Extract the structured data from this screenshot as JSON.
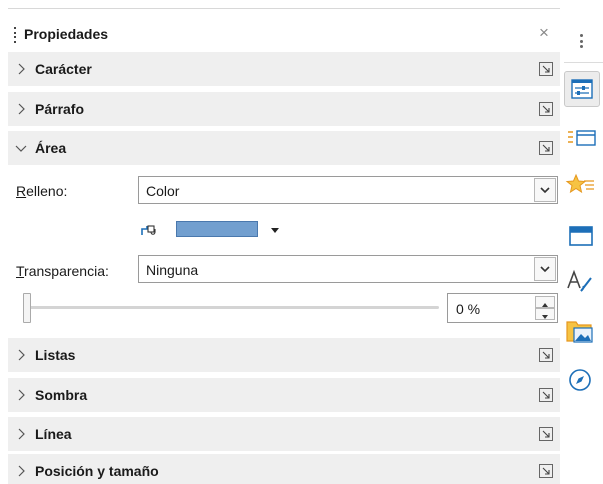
{
  "panel": {
    "title": "Propiedades",
    "close_symbol": "×"
  },
  "sections": {
    "caracter": "Carácter",
    "parrafo": "Párrafo",
    "area": "Área",
    "listas": "Listas",
    "sombra": "Sombra",
    "linea": "Línea",
    "posicion": "Posición y tamaño"
  },
  "area": {
    "fill_label_mnemonic": "R",
    "fill_label_rest": "elleno:",
    "fill_value": "Color",
    "fill_color": "#729fcf",
    "transparency_label_mnemonic": "T",
    "transparency_label_rest": "ransparencia:",
    "transparency_value": "Ninguna",
    "transparency_percent": "0 %",
    "transparency_level": 0
  },
  "sidebar": {
    "items": [
      {
        "name": "properties",
        "active": true
      },
      {
        "name": "styles",
        "active": false
      },
      {
        "name": "gallery",
        "active": false
      },
      {
        "name": "slide-layout",
        "active": false
      },
      {
        "name": "fontwork",
        "active": false
      },
      {
        "name": "image-folder",
        "active": false
      },
      {
        "name": "navigator",
        "active": false
      }
    ]
  },
  "colors": {
    "section_bg": "#efefef",
    "accent_blue": "#1d6fb8",
    "accent_orange": "#e6981f"
  }
}
